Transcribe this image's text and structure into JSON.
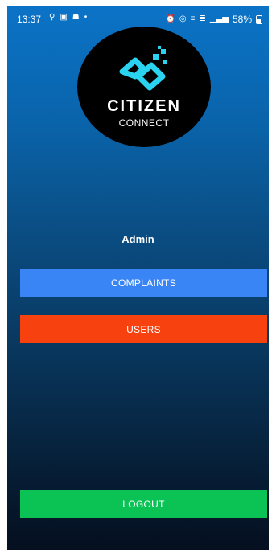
{
  "status_bar": {
    "time": "13:37",
    "battery": "58%",
    "left_icons": [
      "wifi-calling-icon",
      "image-icon",
      "snapchat-icon",
      "dot-icon"
    ],
    "right_icons": [
      "alarm-icon",
      "hotspot-icon",
      "volte-icon",
      "lte-icon",
      "signal-icon",
      "battery-icon"
    ]
  },
  "logo": {
    "title": "CITIZEN",
    "subtitle": "CONNECT",
    "accent_color": "#2ad4f0"
  },
  "main": {
    "role_label": "Admin",
    "complaints_label": "COMPLAINTS",
    "users_label": "USERS",
    "logout_label": "LOGOUT"
  },
  "colors": {
    "complaints": "#3a85f5",
    "users": "#f7410f",
    "logout": "#0bc254"
  }
}
